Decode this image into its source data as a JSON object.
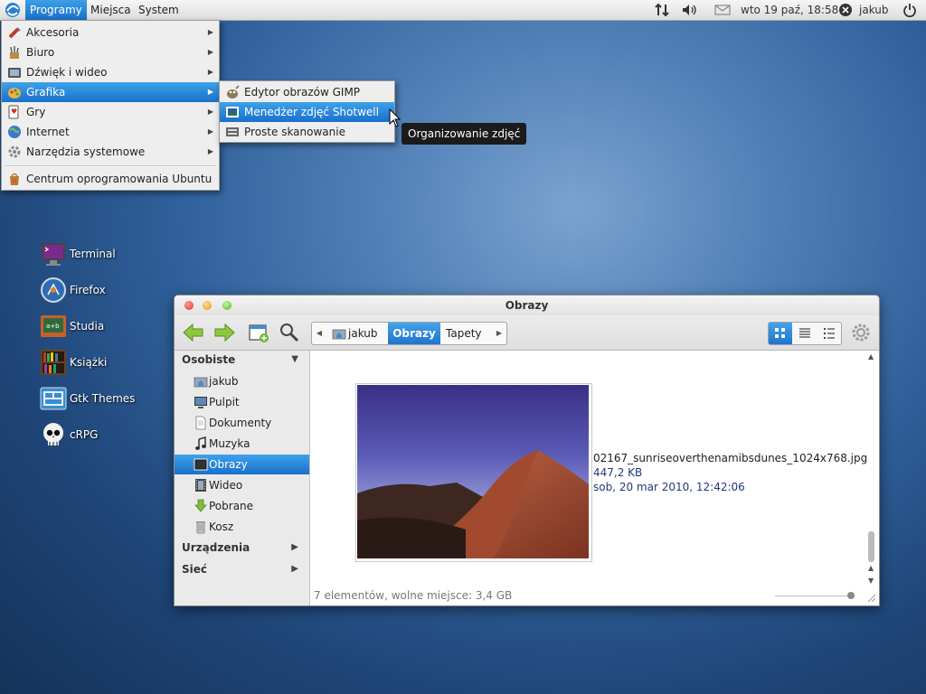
{
  "panel": {
    "menus": [
      "Programy",
      "Miejsca",
      "System"
    ],
    "clock": "wto 19 paź, 18:58",
    "user": "jakub"
  },
  "apps_menu": {
    "items": [
      {
        "label": "Akcesoria",
        "icon": "accessories-icon",
        "submenu": true
      },
      {
        "label": "Biuro",
        "icon": "office-icon",
        "submenu": true
      },
      {
        "label": "Dźwięk i wideo",
        "icon": "multimedia-icon",
        "submenu": true
      },
      {
        "label": "Grafika",
        "icon": "graphics-icon",
        "submenu": true,
        "selected": true
      },
      {
        "label": "Gry",
        "icon": "games-icon",
        "submenu": true
      },
      {
        "label": "Internet",
        "icon": "internet-icon",
        "submenu": true
      },
      {
        "label": "Narzędzia systemowe",
        "icon": "system-tools-icon",
        "submenu": true
      },
      {
        "label": "Centrum oprogramowania Ubuntu",
        "icon": "software-center-icon",
        "submenu": false
      }
    ]
  },
  "graphics_submenu": {
    "items": [
      {
        "label": "Edytor obrazów GIMP",
        "icon": "gimp-icon"
      },
      {
        "label": "Menedżer zdjęć Shotwell",
        "icon": "shotwell-icon",
        "selected": true
      },
      {
        "label": "Proste skanowanie",
        "icon": "scanner-icon"
      }
    ]
  },
  "tooltip": "Organizowanie zdjęć",
  "desktop_icons": [
    {
      "label": "Terminal",
      "icon": "terminal-icon"
    },
    {
      "label": "Firefox",
      "icon": "firefox-icon"
    },
    {
      "label": "Studia",
      "icon": "folder-studia-icon"
    },
    {
      "label": "Książki",
      "icon": "bookshelf-icon"
    },
    {
      "label": "Gtk Themes",
      "icon": "gtk-themes-icon"
    },
    {
      "label": "cRPG",
      "icon": "skull-icon"
    }
  ],
  "file_manager": {
    "title": "Obrazy",
    "breadcrumbs": [
      "jakub",
      "Obrazy",
      "Tapety"
    ],
    "active_crumb": "Obrazy",
    "sidebar": {
      "personal_header": "Osobiste",
      "items": [
        {
          "label": "jakub",
          "icon": "home-folder-icon"
        },
        {
          "label": "Pulpit",
          "icon": "desktop-folder-icon"
        },
        {
          "label": "Dokumenty",
          "icon": "documents-folder-icon"
        },
        {
          "label": "Muzyka",
          "icon": "music-folder-icon"
        },
        {
          "label": "Obrazy",
          "icon": "pictures-folder-icon",
          "selected": true
        },
        {
          "label": "Wideo",
          "icon": "videos-folder-icon"
        },
        {
          "label": "Pobrane",
          "icon": "downloads-folder-icon"
        },
        {
          "label": "Kosz",
          "icon": "trash-icon"
        }
      ],
      "devices_header": "Urządzenia",
      "network_header": "Sieć"
    },
    "file": {
      "name": "02167_sunriseoverthenamibsdunes_1024x768.jpg",
      "size": "447,2 KB",
      "date": "sob, 20 mar 2010, 12:42:06"
    },
    "status": "7 elementów, wolne miejsce: 3,4 GB"
  },
  "colors": {
    "accent": "#1a70cb",
    "file_info_text": "#1f3a7a"
  }
}
